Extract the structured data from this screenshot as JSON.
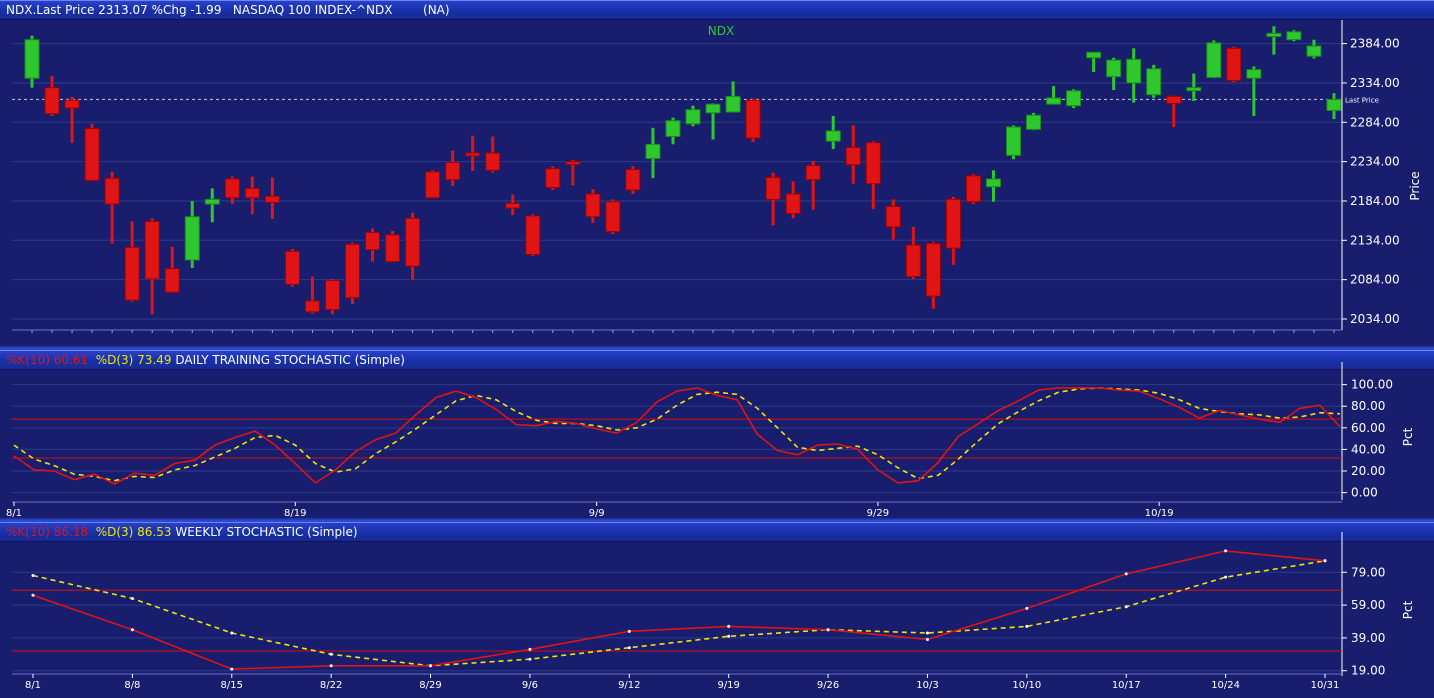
{
  "colors": {
    "background": "#191d6e",
    "up": "#2ec82e",
    "down": "#e01414",
    "k_line": "#e01414",
    "d_line": "#f2e600",
    "grid": "#2e3a8c",
    "level": "#d41010"
  },
  "header": {
    "price_title": "NDX.Last Price 2313.07 %Chg -1.99   NASDAQ 100 INDEX-^NDX        (NA)",
    "daily_k": "%K(10) 60.61",
    "daily_d": "%D(3) 73.49",
    "daily_name": "DAILY TRAINING STOCHASTIC (Simple)",
    "weekly_k": "%K(10) 86.18",
    "weekly_d": "%D(3) 86.53",
    "weekly_name": "WEEKLY STOCHASTIC (Simple)"
  },
  "chart_data": [
    {
      "type": "candlestick",
      "title": "NDX",
      "ylabel": "Price",
      "ylim": [
        2020,
        2414
      ],
      "yticks": [
        "2384.00",
        "2334.00",
        "2284.00",
        "2234.00",
        "2184.00",
        "2134.00",
        "2084.00",
        "2034.00"
      ],
      "last_price": 2313.07,
      "last_price_label": "Last Price",
      "candles": [
        {
          "o": 2340,
          "h": 2394,
          "l": 2328,
          "c": 2389
        },
        {
          "o": 2328,
          "h": 2343,
          "l": 2292,
          "c": 2295
        },
        {
          "o": 2312,
          "h": 2316,
          "l": 2258,
          "c": 2302
        },
        {
          "o": 2276,
          "h": 2282,
          "l": 2212,
          "c": 2210
        },
        {
          "o": 2213,
          "h": 2221,
          "l": 2130,
          "c": 2180
        },
        {
          "o": 2125,
          "h": 2158,
          "l": 2056,
          "c": 2058
        },
        {
          "o": 2158,
          "h": 2162,
          "l": 2040,
          "c": 2085
        },
        {
          "o": 2098,
          "h": 2126,
          "l": 2067,
          "c": 2068
        },
        {
          "o": 2109,
          "h": 2184,
          "l": 2099,
          "c": 2164
        },
        {
          "o": 2180,
          "h": 2200,
          "l": 2157,
          "c": 2186
        },
        {
          "o": 2212,
          "h": 2215,
          "l": 2180,
          "c": 2188
        },
        {
          "o": 2200,
          "h": 2215,
          "l": 2167,
          "c": 2188
        },
        {
          "o": 2190,
          "h": 2214,
          "l": 2161,
          "c": 2182
        },
        {
          "o": 2120,
          "h": 2123,
          "l": 2075,
          "c": 2078
        },
        {
          "o": 2057,
          "h": 2088,
          "l": 2041,
          "c": 2043
        },
        {
          "o": 2083,
          "h": 2085,
          "l": 2040,
          "c": 2046
        },
        {
          "o": 2129,
          "h": 2131,
          "l": 2053,
          "c": 2061
        },
        {
          "o": 2144,
          "h": 2149,
          "l": 2107,
          "c": 2122
        },
        {
          "o": 2141,
          "h": 2146,
          "l": 2107,
          "c": 2107
        },
        {
          "o": 2162,
          "h": 2169,
          "l": 2084,
          "c": 2101
        },
        {
          "o": 2221,
          "h": 2223,
          "l": 2188,
          "c": 2188
        },
        {
          "o": 2233,
          "h": 2248,
          "l": 2203,
          "c": 2211
        },
        {
          "o": 2245,
          "h": 2267,
          "l": 2222,
          "c": 2243
        },
        {
          "o": 2245,
          "h": 2266,
          "l": 2220,
          "c": 2223
        },
        {
          "o": 2181,
          "h": 2192,
          "l": 2166,
          "c": 2175
        },
        {
          "o": 2165,
          "h": 2167,
          "l": 2114,
          "c": 2116
        },
        {
          "o": 2225,
          "h": 2228,
          "l": 2198,
          "c": 2201
        },
        {
          "o": 2234,
          "h": 2236,
          "l": 2204,
          "c": 2233
        },
        {
          "o": 2193,
          "h": 2199,
          "l": 2156,
          "c": 2164
        },
        {
          "o": 2183,
          "h": 2186,
          "l": 2142,
          "c": 2145
        },
        {
          "o": 2224,
          "h": 2228,
          "l": 2193,
          "c": 2198
        },
        {
          "o": 2238,
          "h": 2277,
          "l": 2213,
          "c": 2256
        },
        {
          "o": 2266,
          "h": 2290,
          "l": 2256,
          "c": 2286
        },
        {
          "o": 2282,
          "h": 2305,
          "l": 2279,
          "c": 2300
        },
        {
          "o": 2296,
          "h": 2308,
          "l": 2262,
          "c": 2307
        },
        {
          "o": 2297,
          "h": 2336,
          "l": 2297,
          "c": 2317
        },
        {
          "o": 2312,
          "h": 2314,
          "l": 2259,
          "c": 2264
        },
        {
          "o": 2214,
          "h": 2220,
          "l": 2153,
          "c": 2186
        },
        {
          "o": 2193,
          "h": 2209,
          "l": 2162,
          "c": 2168
        },
        {
          "o": 2229,
          "h": 2235,
          "l": 2173,
          "c": 2211
        },
        {
          "o": 2260,
          "h": 2292,
          "l": 2250,
          "c": 2273
        },
        {
          "o": 2252,
          "h": 2280,
          "l": 2206,
          "c": 2230
        },
        {
          "o": 2258,
          "h": 2260,
          "l": 2174,
          "c": 2206
        },
        {
          "o": 2177,
          "h": 2186,
          "l": 2135,
          "c": 2151
        },
        {
          "o": 2128,
          "h": 2151,
          "l": 2085,
          "c": 2088
        },
        {
          "o": 2130,
          "h": 2132,
          "l": 2047,
          "c": 2063
        },
        {
          "o": 2186,
          "h": 2189,
          "l": 2103,
          "c": 2124
        },
        {
          "o": 2216,
          "h": 2218,
          "l": 2180,
          "c": 2183
        },
        {
          "o": 2202,
          "h": 2223,
          "l": 2183,
          "c": 2212
        },
        {
          "o": 2242,
          "h": 2280,
          "l": 2237,
          "c": 2278
        },
        {
          "o": 2275,
          "h": 2296,
          "l": 2274,
          "c": 2293
        },
        {
          "o": 2307,
          "h": 2330,
          "l": 2307,
          "c": 2315
        },
        {
          "o": 2305,
          "h": 2326,
          "l": 2302,
          "c": 2324
        },
        {
          "o": 2366,
          "h": 2373,
          "l": 2348,
          "c": 2373
        },
        {
          "o": 2342,
          "h": 2366,
          "l": 2325,
          "c": 2363
        },
        {
          "o": 2334,
          "h": 2378,
          "l": 2309,
          "c": 2364
        },
        {
          "o": 2319,
          "h": 2357,
          "l": 2315,
          "c": 2352
        },
        {
          "o": 2317,
          "h": 2318,
          "l": 2278,
          "c": 2308
        },
        {
          "o": 2328,
          "h": 2346,
          "l": 2311,
          "c": 2328
        },
        {
          "o": 2341,
          "h": 2388,
          "l": 2340,
          "c": 2385
        },
        {
          "o": 2378,
          "h": 2380,
          "l": 2335,
          "c": 2337
        },
        {
          "o": 2340,
          "h": 2355,
          "l": 2292,
          "c": 2351
        },
        {
          "o": 2393,
          "h": 2406,
          "l": 2370,
          "c": 2397
        },
        {
          "o": 2389,
          "h": 2401,
          "l": 2387,
          "c": 2399
        },
        {
          "o": 2368,
          "h": 2389,
          "l": 2365,
          "c": 2381
        },
        {
          "o": 2299,
          "h": 2321,
          "l": 2288,
          "c": 2313
        }
      ]
    },
    {
      "type": "line",
      "title": "DAILY TRAINING STOCHASTIC (Simple)",
      "ylabel": "Pct",
      "ylim": [
        -5,
        108
      ],
      "yticks": [
        "100.00",
        "80.00",
        "60.00",
        "40.00",
        "20.00",
        "0.00"
      ],
      "levels": [
        68,
        32
      ],
      "x": [
        "8/1",
        "8/19",
        "9/9",
        "9/29",
        "10/19"
      ],
      "series": [
        {
          "name": "%K(10)",
          "values": [
            34,
            21,
            20,
            12,
            17,
            8,
            18,
            16,
            27,
            30,
            44,
            51,
            57,
            44,
            27,
            9,
            21,
            38,
            49,
            55,
            72,
            88,
            94,
            88,
            77,
            63,
            62,
            66,
            64,
            59,
            55,
            65,
            84,
            94,
            97,
            90,
            86,
            54,
            39,
            35,
            44,
            45,
            40,
            21,
            9,
            11,
            28,
            52,
            64,
            76,
            85,
            95,
            97,
            97,
            97,
            95,
            94,
            87,
            79,
            69,
            76,
            72,
            68,
            65,
            78,
            81,
            61
          ]
        },
        {
          "name": "%D(3)",
          "values": [
            44,
            31,
            25,
            17,
            15,
            11,
            15,
            14,
            21,
            25,
            33,
            41,
            51,
            53,
            44,
            27,
            19,
            22,
            36,
            47,
            59,
            72,
            85,
            90,
            86,
            75,
            67,
            64,
            64,
            62,
            58,
            60,
            68,
            81,
            91,
            93,
            91,
            78,
            60,
            42,
            39,
            41,
            43,
            35,
            23,
            13,
            16,
            31,
            48,
            64,
            75,
            85,
            93,
            96,
            97,
            96,
            95,
            92,
            86,
            78,
            75,
            73,
            72,
            69,
            70,
            74,
            73
          ]
        }
      ]
    },
    {
      "type": "line",
      "title": "WEEKLY STOCHASTIC (Simple)",
      "ylabel": "Pct",
      "ylim": [
        17,
        95
      ],
      "yticks": [
        "79.00",
        "59.00",
        "39.00",
        "19.00"
      ],
      "levels": [
        68,
        31
      ],
      "x": [
        "8/1",
        "8/8",
        "8/15",
        "8/22",
        "8/29",
        "9/6",
        "9/12",
        "9/19",
        "9/26",
        "10/3",
        "10/10",
        "10/17",
        "10/24",
        "10/31"
      ],
      "series": [
        {
          "name": "%K(10)",
          "values": [
            65,
            44,
            20,
            22,
            22,
            32,
            43,
            46,
            44,
            38,
            57,
            78,
            92,
            86
          ]
        },
        {
          "name": "%D(3)",
          "values": [
            77,
            63,
            42,
            29,
            22,
            26,
            33,
            40,
            44,
            42,
            46,
            58,
            76,
            86
          ]
        }
      ]
    }
  ]
}
